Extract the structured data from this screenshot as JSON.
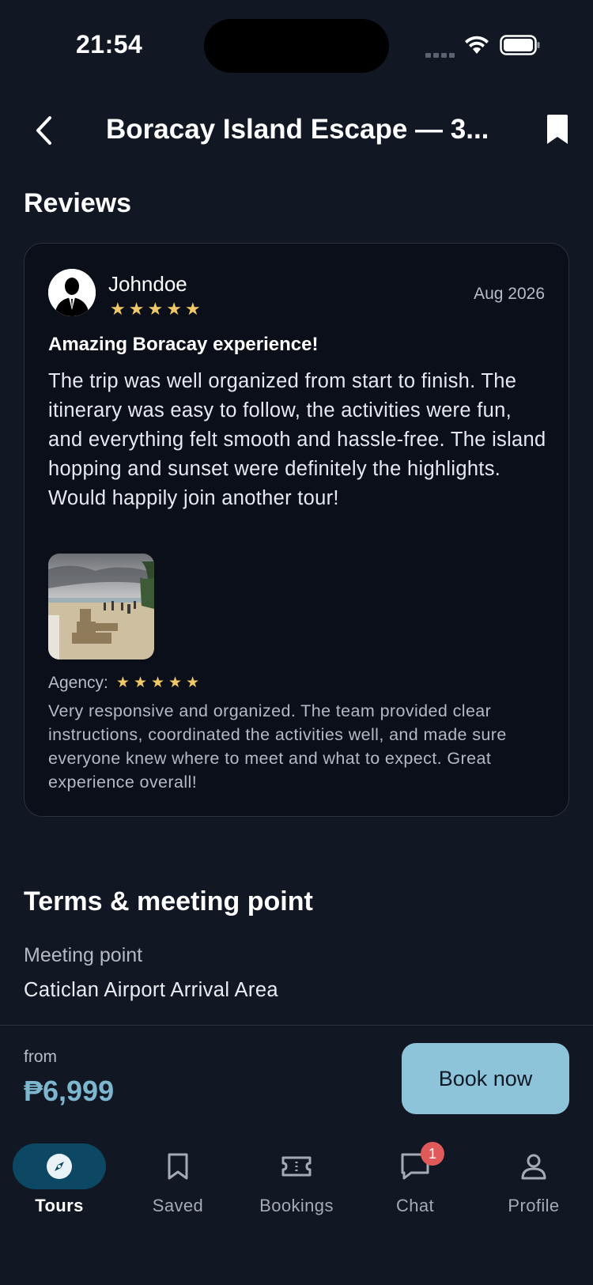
{
  "status_bar": {
    "time": "21:54"
  },
  "header": {
    "title": "Boracay Island Escape — 3..."
  },
  "reviews": {
    "section_title": "Reviews",
    "items": [
      {
        "reviewer": "Johndoe",
        "rating": 5,
        "date": "Aug 2026",
        "title": "Amazing Boracay experience!",
        "body": "The trip was well organized from start to finish. The itinerary was easy to follow, the activities were fun, and everything felt smooth and hassle-free. The island hopping and sunset were definitely the highlights. Would happily join another tour!",
        "agency_label": "Agency:",
        "agency_rating": 5,
        "agency_body": "Very responsive and organized. The team provided clear instructions, coordinated the activities well, and made sure everyone knew where to meet and what to expect. Great experience overall!"
      }
    ]
  },
  "terms": {
    "section_title": "Terms & meeting point",
    "meeting_label": "Meeting point",
    "meeting_value": "Caticlan Airport Arrival Area"
  },
  "booking": {
    "from_label": "from",
    "price": "₱6,999",
    "book_label": "Book now"
  },
  "tabs": [
    {
      "label": "Tours",
      "icon": "compass-icon",
      "active": true
    },
    {
      "label": "Saved",
      "icon": "bookmark-icon",
      "active": false
    },
    {
      "label": "Bookings",
      "icon": "ticket-icon",
      "active": false
    },
    {
      "label": "Chat",
      "icon": "chat-icon",
      "active": false,
      "badge": "1"
    },
    {
      "label": "Profile",
      "icon": "person-icon",
      "active": false
    }
  ],
  "colors": {
    "background": "#111723",
    "card": "#0b0f19",
    "accent": "#8ec4da",
    "price": "#7db6cf",
    "star": "#f1c867",
    "active_tab": "#0c4863",
    "badge": "#e05a5a"
  }
}
